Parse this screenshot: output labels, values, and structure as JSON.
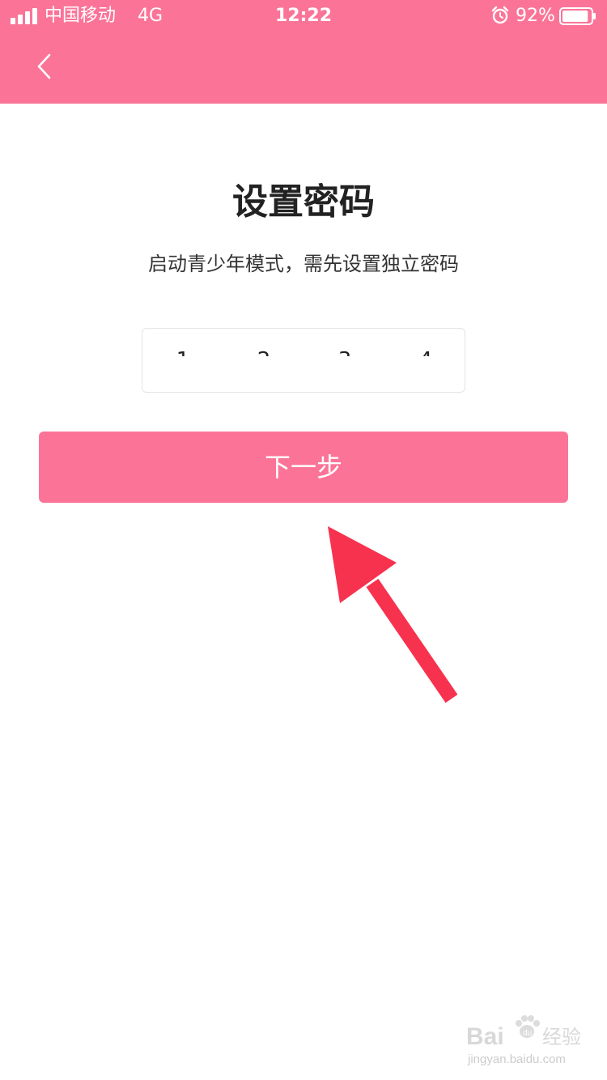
{
  "status_bar": {
    "carrier": "中国移动",
    "network": "4G",
    "time": "12:22",
    "battery_percent": "92%",
    "battery_level": 0.92,
    "icons": [
      "signal-icon",
      "alarm-icon",
      "battery-icon"
    ]
  },
  "header": {
    "back_icon": "chevron-left-icon",
    "background_color": "#FB7497"
  },
  "main": {
    "title": "设置密码",
    "subtitle": "启动青少年模式，需先设置独立密码",
    "password_digits": [
      "1",
      "2",
      "3",
      "4"
    ],
    "next_button_label": "下一步",
    "annotation_icon": "red-arrow-icon"
  },
  "watermark": {
    "logo_text": "Bai",
    "logo_cn": "经验",
    "url": "jingyan.baidu.com"
  },
  "colors": {
    "accent": "#FB7497",
    "arrow": "#F7324E"
  }
}
